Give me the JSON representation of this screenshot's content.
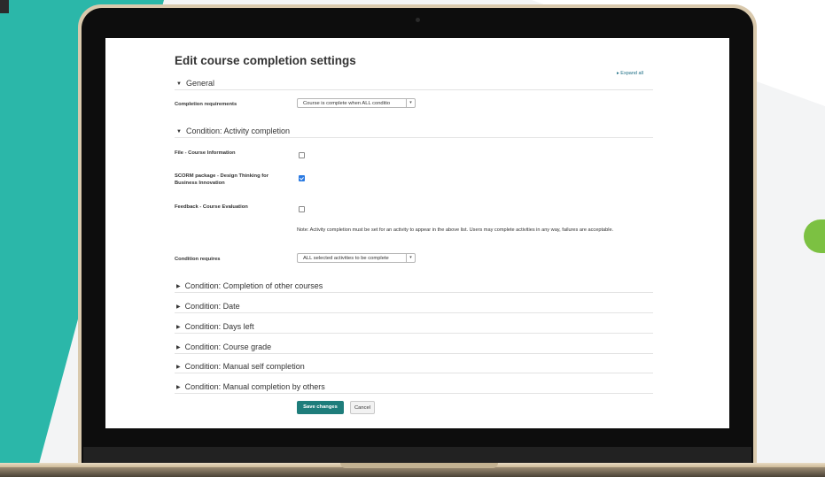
{
  "page": {
    "title": "Edit course completion settings",
    "expand_all": "Expand all"
  },
  "sections": {
    "general": "General",
    "activity": "Condition: Activity completion",
    "other_courses": "Condition: Completion of other courses",
    "date": "Condition: Date",
    "days_left": "Condition: Days left",
    "course_grade": "Condition: Course grade",
    "self_completion": "Condition: Manual self completion",
    "by_others": "Condition: Manual completion by others"
  },
  "fields": {
    "completion_requirements_label": "Completion requirements",
    "completion_requirements_value": "Course is complete when ALL conditio",
    "activity_file_label": "File - Course Information",
    "activity_file_checked": false,
    "activity_scorm_label": "SCORM package - Design Thinking for Business Innovation",
    "activity_scorm_checked": true,
    "activity_feedback_label": "Feedback - Course Evaluation",
    "activity_feedback_checked": false,
    "note": "Note: Activity completion must be set for an activity to appear in the above list. Users may complete activities in any way, failures are acceptable.",
    "condition_requires_label": "Condition requires",
    "condition_requires_value": "ALL selected activities to be complete"
  },
  "buttons": {
    "save": "Save changes",
    "cancel": "Cancel"
  },
  "colors": {
    "teal_background": "#2bb7a9",
    "primary_button": "#1e7d7b",
    "link": "#1b6d84",
    "leaf_green": "#7cc142"
  }
}
